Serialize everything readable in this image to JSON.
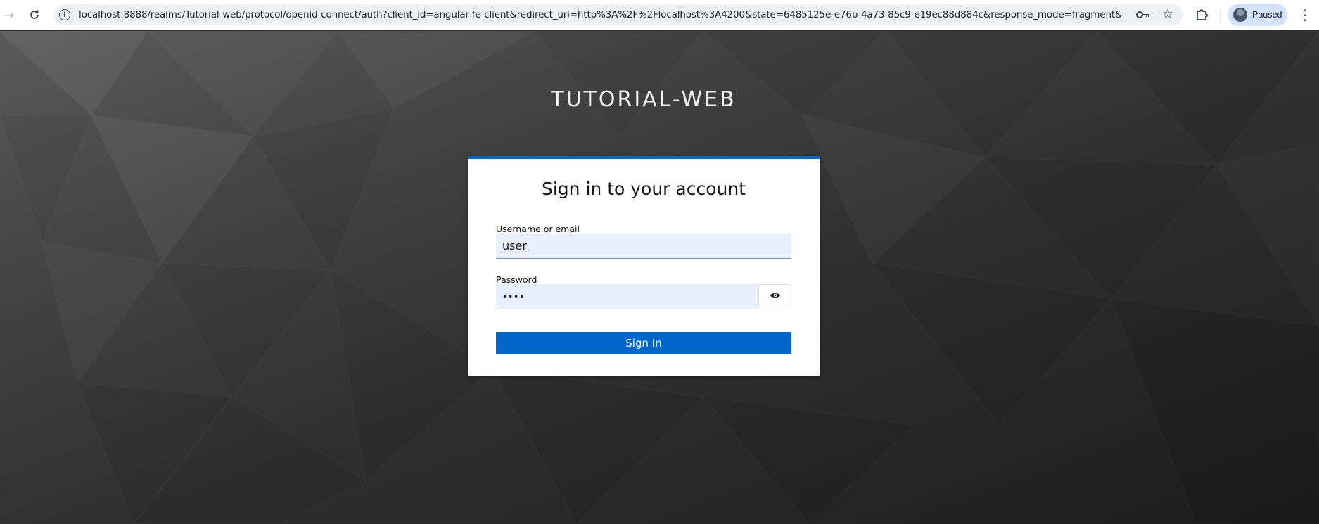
{
  "browser": {
    "url": "localhost:8888/realms/Tutorial-web/protocol/openid-connect/auth?client_id=angular-fe-client&redirect_uri=http%3A%2F%2Flocalhost%3A4200&state=6485125e-e76b-4a73-85c9-e19ec88d884c&response_mode=fragment&response_type...",
    "profile_status": "Paused",
    "icons": {
      "back": "arrow-right-icon",
      "reload": "reload-icon",
      "info": "info-icon",
      "key": "key-icon",
      "star": "star-icon",
      "extensions": "puzzle-icon",
      "menu": "kebab-menu-icon"
    }
  },
  "page": {
    "realm_title": "TUTORIAL-WEB",
    "card": {
      "title": "Sign in to your account",
      "username_label": "Username or email",
      "username_value": "user",
      "password_label": "Password",
      "password_value": "••••",
      "show_password_icon": "eye-icon",
      "signin_label": "Sign In"
    }
  },
  "colors": {
    "accent": "#0066cc",
    "input_bg": "#e8f0fe",
    "profile_bg": "#d3e3fd"
  }
}
